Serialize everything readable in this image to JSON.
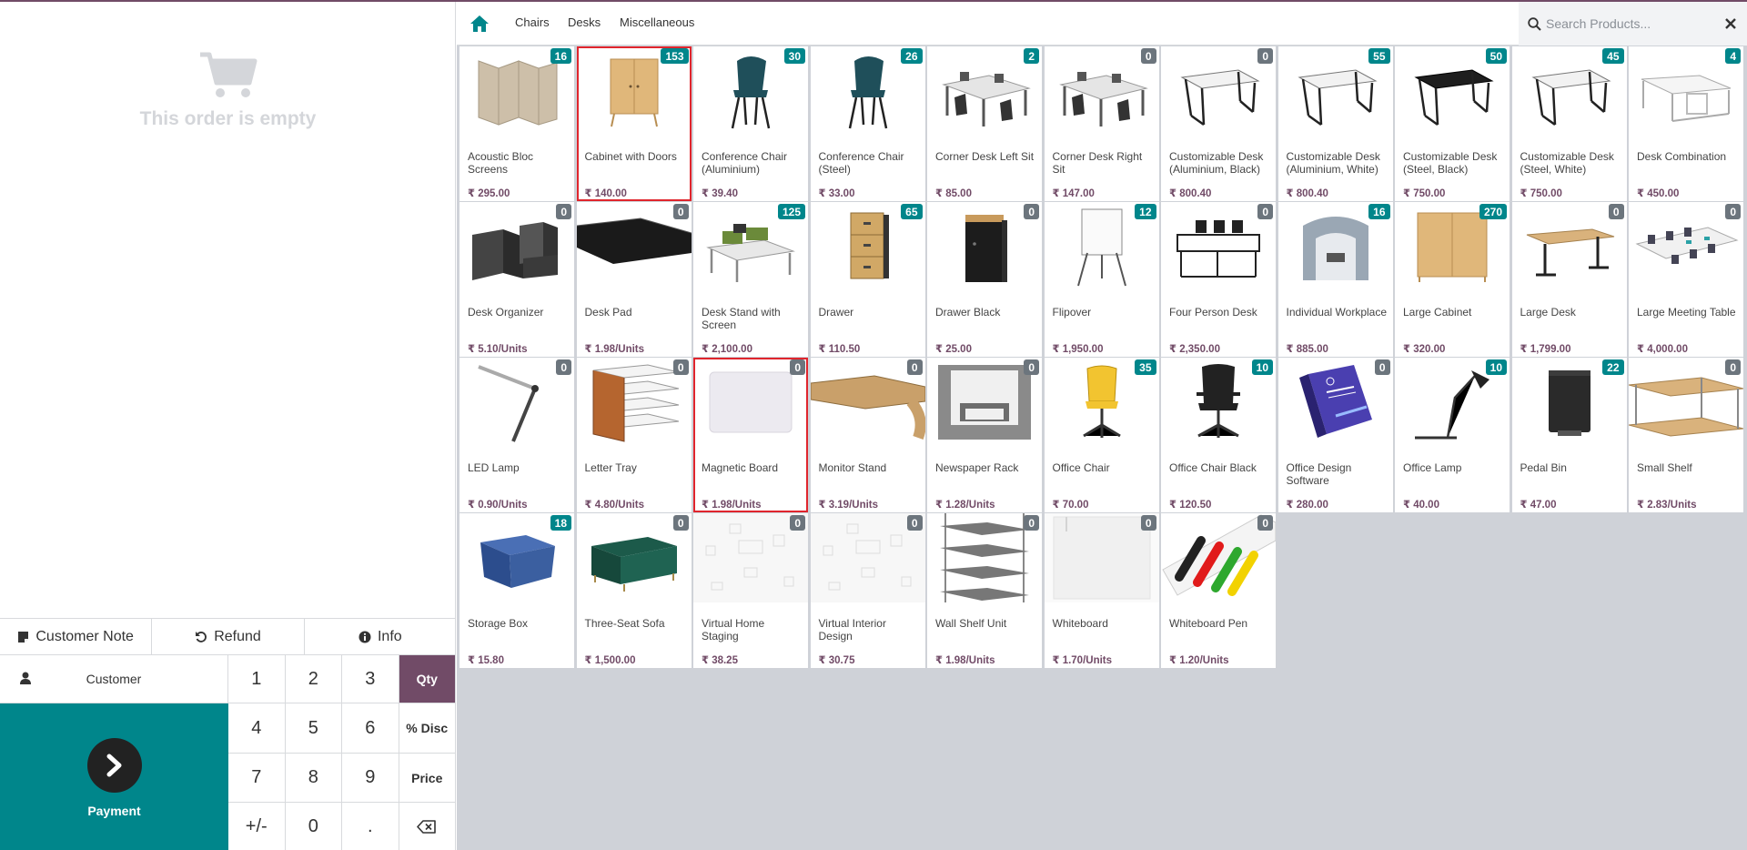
{
  "order": {
    "empty_text": "This order is empty"
  },
  "actions": [
    {
      "label": "Customer Note",
      "icon": "note-icon"
    },
    {
      "label": "Refund",
      "icon": "undo-icon"
    },
    {
      "label": "Info",
      "icon": "info-icon"
    }
  ],
  "customer": {
    "label": "Customer"
  },
  "payment": {
    "label": "Payment"
  },
  "numpad": [
    "1",
    "2",
    "3",
    "Qty",
    "4",
    "5",
    "6",
    "% Disc",
    "7",
    "8",
    "9",
    "Price",
    "+/-",
    "0",
    "."
  ],
  "numpad_active": "Qty",
  "categories": [
    "Chairs",
    "Desks",
    "Miscellaneous"
  ],
  "search": {
    "placeholder": "Search Products..."
  },
  "colors": {
    "brand": "#714b67",
    "teal": "#00868b",
    "selected_border": "#e0252d"
  },
  "products": [
    {
      "name": "Acoustic Bloc Screens",
      "price": "₹ 295.00",
      "qty": "16",
      "img": "screen"
    },
    {
      "name": "Cabinet with Doors",
      "price": "₹ 140.00",
      "qty": "153",
      "img": "cabinet",
      "selected": true
    },
    {
      "name": "Conference Chair (Aluminium)",
      "price": "₹ 39.40",
      "qty": "30",
      "img": "chair"
    },
    {
      "name": "Conference Chair (Steel)",
      "price": "₹ 33.00",
      "qty": "26",
      "img": "chair"
    },
    {
      "name": "Corner Desk Left Sit",
      "price": "₹ 85.00",
      "qty": "2",
      "img": "corner"
    },
    {
      "name": "Corner Desk Right Sit",
      "price": "₹ 147.00",
      "qty": "0",
      "img": "corner"
    },
    {
      "name": "Customizable Desk (Aluminium, Black)",
      "price": "₹ 800.40",
      "qty": "0",
      "img": "deskwhite"
    },
    {
      "name": "Customizable Desk (Aluminium, White)",
      "price": "₹ 800.40",
      "qty": "55",
      "img": "deskwhite"
    },
    {
      "name": "Customizable Desk (Steel, Black)",
      "price": "₹ 750.00",
      "qty": "50",
      "img": "deskblack"
    },
    {
      "name": "Customizable Desk (Steel, White)",
      "price": "₹ 750.00",
      "qty": "45",
      "img": "deskwhite"
    },
    {
      "name": "Desk Combination",
      "price": "₹ 450.00",
      "qty": "4",
      "img": "deskcombo"
    },
    {
      "name": "Desk Organizer",
      "price": "₹ 5.10/Units",
      "qty": "0",
      "img": "organizer"
    },
    {
      "name": "Desk Pad",
      "price": "₹ 1.98/Units",
      "qty": "0",
      "img": "pad"
    },
    {
      "name": "Desk Stand with Screen",
      "price": "₹ 2,100.00",
      "qty": "125",
      "img": "stand"
    },
    {
      "name": "Drawer",
      "price": "₹ 110.50",
      "qty": "65",
      "img": "drawer"
    },
    {
      "name": "Drawer Black",
      "price": "₹ 25.00",
      "qty": "0",
      "img": "drawerblack"
    },
    {
      "name": "Flipover",
      "price": "₹ 1,950.00",
      "qty": "12",
      "img": "flipover"
    },
    {
      "name": "Four Person Desk",
      "price": "₹ 2,350.00",
      "qty": "0",
      "img": "fourdesk"
    },
    {
      "name": "Individual Workplace",
      "price": "₹ 885.00",
      "qty": "16",
      "img": "pod"
    },
    {
      "name": "Large Cabinet",
      "price": "₹ 320.00",
      "qty": "270",
      "img": "largecab"
    },
    {
      "name": "Large Desk",
      "price": "₹ 1,799.00",
      "qty": "0",
      "img": "largedesk"
    },
    {
      "name": "Large Meeting Table",
      "price": "₹ 4,000.00",
      "qty": "0",
      "img": "meeting"
    },
    {
      "name": "LED Lamp",
      "price": "₹ 0.90/Units",
      "qty": "0",
      "img": "ledlamp"
    },
    {
      "name": "Letter Tray",
      "price": "₹ 4.80/Units",
      "qty": "0",
      "img": "tray"
    },
    {
      "name": "Magnetic Board",
      "price": "₹ 1.98/Units",
      "qty": "0",
      "img": "board",
      "selected": true
    },
    {
      "name": "Monitor Stand",
      "price": "₹ 3.19/Units",
      "qty": "0",
      "img": "monitorstand"
    },
    {
      "name": "Newspaper Rack",
      "price": "₹ 1.28/Units",
      "qty": "0",
      "img": "rack"
    },
    {
      "name": "Office Chair",
      "price": "₹ 70.00",
      "qty": "35",
      "img": "officechair"
    },
    {
      "name": "Office Chair Black",
      "price": "₹ 120.50",
      "qty": "10",
      "img": "officechairblack"
    },
    {
      "name": "Office Design Software",
      "price": "₹ 280.00",
      "qty": "0",
      "img": "software"
    },
    {
      "name": "Office Lamp",
      "price": "₹ 40.00",
      "qty": "10",
      "img": "officelamp"
    },
    {
      "name": "Pedal Bin",
      "price": "₹ 47.00",
      "qty": "22",
      "img": "bin"
    },
    {
      "name": "Small Shelf",
      "price": "₹ 2.83/Units",
      "qty": "0",
      "img": "smallshelf"
    },
    {
      "name": "Storage Box",
      "price": "₹ 15.80",
      "qty": "18",
      "img": "box"
    },
    {
      "name": "Three-Seat Sofa",
      "price": "₹ 1,500.00",
      "qty": "0",
      "img": "sofa"
    },
    {
      "name": "Virtual Home Staging",
      "price": "₹ 38.25",
      "qty": "0",
      "img": "virtual"
    },
    {
      "name": "Virtual Interior Design",
      "price": "₹ 30.75",
      "qty": "0",
      "img": "virtual"
    },
    {
      "name": "Wall Shelf Unit",
      "price": "₹ 1.98/Units",
      "qty": "0",
      "img": "wallshelf"
    },
    {
      "name": "Whiteboard",
      "price": "₹ 1.70/Units",
      "qty": "0",
      "img": "whiteboard"
    },
    {
      "name": "Whiteboard Pen",
      "price": "₹ 1.20/Units",
      "qty": "0",
      "img": "pens"
    }
  ]
}
